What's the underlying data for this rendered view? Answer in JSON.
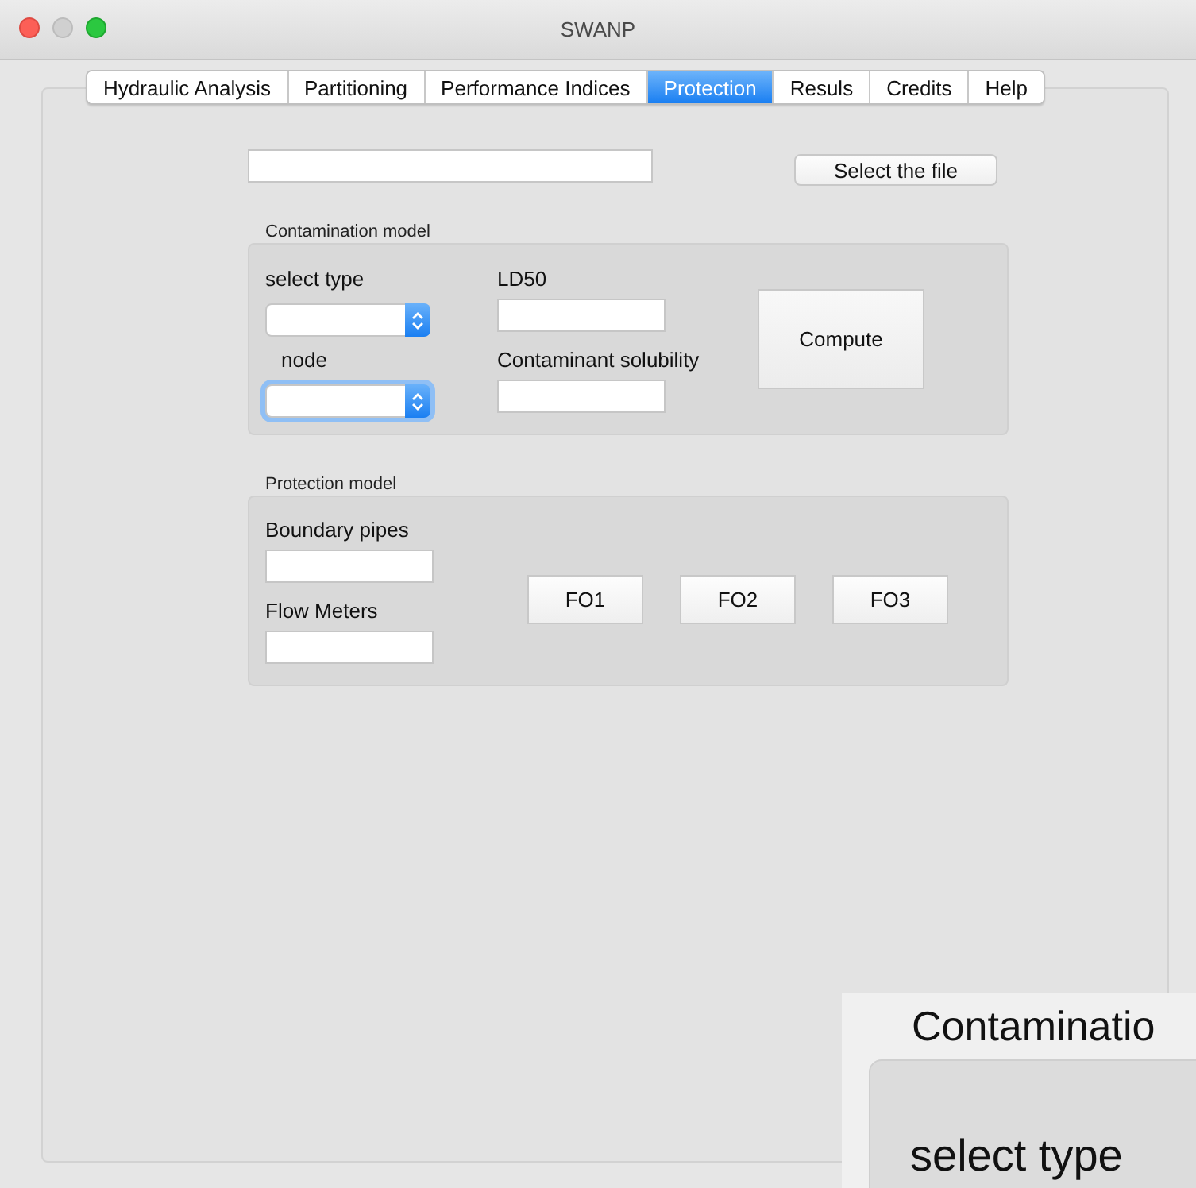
{
  "window": {
    "title": "SWANP"
  },
  "tabs": [
    {
      "label": "Hydraulic Analysis",
      "selected": false
    },
    {
      "label": "Partitioning",
      "selected": false
    },
    {
      "label": "Performance Indices",
      "selected": false
    },
    {
      "label": "Protection",
      "selected": true
    },
    {
      "label": "Resuls",
      "selected": false
    },
    {
      "label": "Credits",
      "selected": false
    },
    {
      "label": "Help",
      "selected": false
    }
  ],
  "select_file_button": "Select the file",
  "contamination_model": {
    "title": "Contamination model",
    "select_type_label": "select type",
    "type_select": {
      "focused": false
    },
    "node_label": "node",
    "node_select": {
      "focused": true
    },
    "ld50_label": "LD50",
    "solubility_label": "Contaminant solubility",
    "compute_button": "Compute"
  },
  "protection_model": {
    "title": "Protection model",
    "boundary_label": "Boundary pipes",
    "flow_label": "Flow Meters",
    "buttons": [
      "FO1",
      "FO2",
      "FO3"
    ]
  },
  "magnified_inset": {
    "title": "Contaminatio",
    "label": "select type"
  }
}
